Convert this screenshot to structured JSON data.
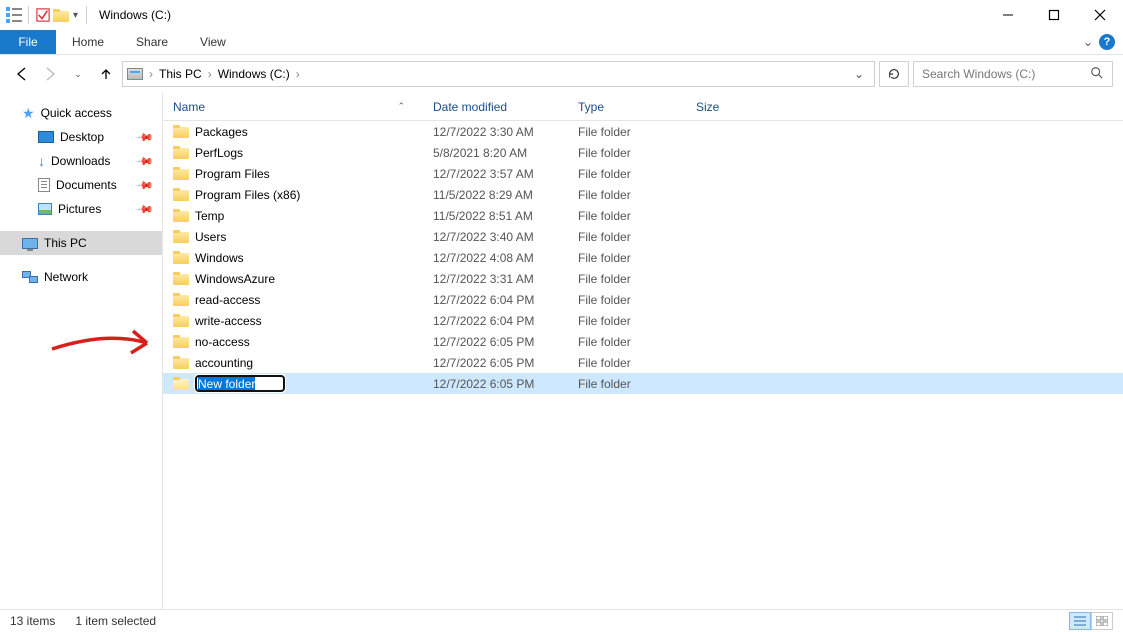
{
  "titlebar": {
    "title": "Windows (C:)"
  },
  "ribbon": {
    "file": "File",
    "tabs": [
      "Home",
      "Share",
      "View"
    ]
  },
  "breadcrumbs": [
    "This PC",
    "Windows (C:)"
  ],
  "search": {
    "placeholder": "Search Windows (C:)"
  },
  "navpane": {
    "quick_access": "Quick access",
    "quick_items": [
      {
        "label": "Desktop",
        "pin": true
      },
      {
        "label": "Downloads",
        "pin": true
      },
      {
        "label": "Documents",
        "pin": true
      },
      {
        "label": "Pictures",
        "pin": true
      }
    ],
    "this_pc": "This PC",
    "network": "Network"
  },
  "columns": {
    "name": "Name",
    "date": "Date modified",
    "type": "Type",
    "size": "Size"
  },
  "files": [
    {
      "name": "Packages",
      "date": "12/7/2022 3:30 AM",
      "type": "File folder"
    },
    {
      "name": "PerfLogs",
      "date": "5/8/2021 8:20 AM",
      "type": "File folder"
    },
    {
      "name": "Program Files",
      "date": "12/7/2022 3:57 AM",
      "type": "File folder"
    },
    {
      "name": "Program Files (x86)",
      "date": "11/5/2022 8:29 AM",
      "type": "File folder"
    },
    {
      "name": "Temp",
      "date": "11/5/2022 8:51 AM",
      "type": "File folder"
    },
    {
      "name": "Users",
      "date": "12/7/2022 3:40 AM",
      "type": "File folder"
    },
    {
      "name": "Windows",
      "date": "12/7/2022 4:08 AM",
      "type": "File folder"
    },
    {
      "name": "WindowsAzure",
      "date": "12/7/2022 3:31 AM",
      "type": "File folder"
    },
    {
      "name": "read-access",
      "date": "12/7/2022 6:04 PM",
      "type": "File folder"
    },
    {
      "name": "write-access",
      "date": "12/7/2022 6:04 PM",
      "type": "File folder"
    },
    {
      "name": "no-access",
      "date": "12/7/2022 6:05 PM",
      "type": "File folder"
    },
    {
      "name": "accounting",
      "date": "12/7/2022 6:05 PM",
      "type": "File folder"
    },
    {
      "name": "New folder",
      "date": "12/7/2022 6:05 PM",
      "type": "File folder",
      "selected": true,
      "editing": true
    }
  ],
  "status": {
    "count": "13 items",
    "selected": "1 item selected"
  }
}
